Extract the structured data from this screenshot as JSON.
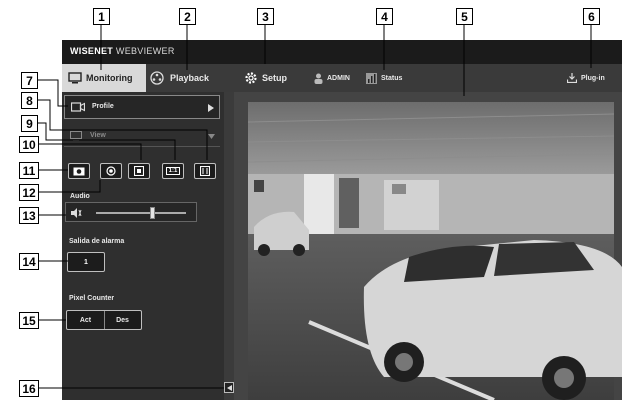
{
  "app": {
    "brand_bold": "WISENET",
    "brand_rest": " WEBVIEWER"
  },
  "nav": {
    "monitoring": "Monitoring",
    "playback": "Playback",
    "setup": "Setup",
    "admin": "ADMIN",
    "status": "Status",
    "plugin": "Plug-in"
  },
  "sidebar": {
    "profile": "Profile",
    "view": "View",
    "audio": "Audio",
    "ratio_label": "1:1",
    "alarm_title": "Salida de alarma",
    "alarm_button": "1",
    "pixel_title": "Pixel Counter",
    "pixel_on": "Act",
    "pixel_off": "Des",
    "audio_volume": 0.62
  },
  "callouts": [
    "1",
    "2",
    "3",
    "4",
    "5",
    "6",
    "7",
    "8",
    "9",
    "10",
    "11",
    "12",
    "13",
    "14",
    "15",
    "16"
  ],
  "colors": {
    "active_tab": "#d9d9d9",
    "frame": "#2b2b2b",
    "topbar": "#1b1b1b"
  }
}
